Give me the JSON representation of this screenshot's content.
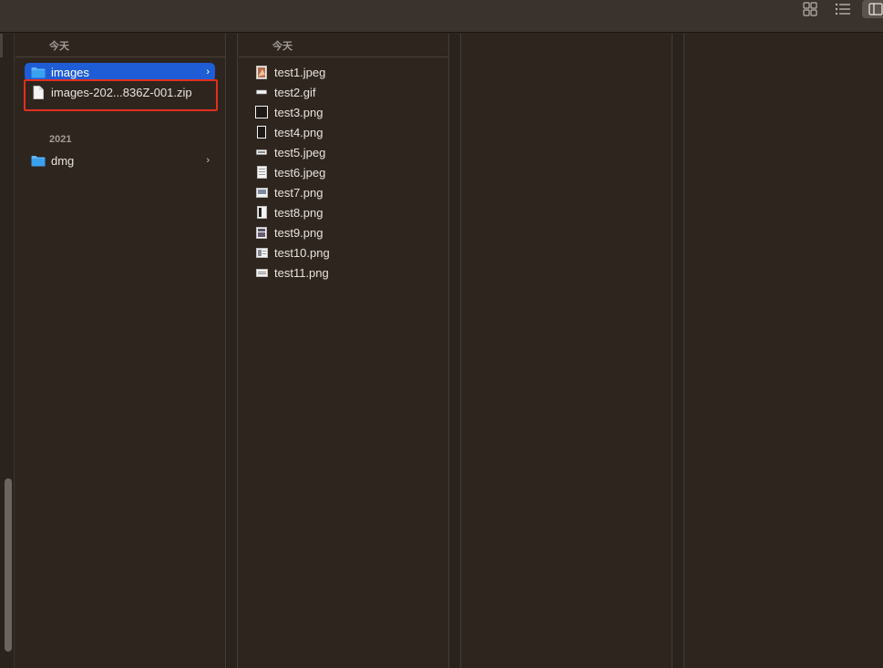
{
  "toolbar": {
    "icons": [
      "grid-view-icon",
      "list-view-icon",
      "column-view-icon"
    ]
  },
  "column1": {
    "section_today": "今天",
    "section_2021": "2021",
    "items": [
      {
        "label": "images",
        "type": "folder",
        "selected": true,
        "has_children": true
      },
      {
        "label": "images-202...836Z-001.zip",
        "type": "zip",
        "selected": false,
        "has_children": false
      },
      {
        "label": "dmg",
        "type": "folder",
        "selected": false,
        "has_children": true
      }
    ]
  },
  "column2": {
    "section_today": "今天",
    "files": [
      {
        "label": "test1.jpeg",
        "icon": "image-thumb-icon"
      },
      {
        "label": "test2.gif",
        "icon": "image-thumb-icon"
      },
      {
        "label": "test3.png",
        "icon": "image-thumb-icon"
      },
      {
        "label": "test4.png",
        "icon": "image-thumb-icon"
      },
      {
        "label": "test5.jpeg",
        "icon": "image-thumb-icon"
      },
      {
        "label": "test6.jpeg",
        "icon": "image-thumb-icon"
      },
      {
        "label": "test7.png",
        "icon": "image-thumb-icon"
      },
      {
        "label": "test8.png",
        "icon": "image-thumb-icon"
      },
      {
        "label": "test9.png",
        "icon": "image-thumb-icon"
      },
      {
        "label": "test10.png",
        "icon": "image-thumb-icon"
      },
      {
        "label": "test11.png",
        "icon": "image-thumb-icon"
      }
    ]
  },
  "chevron_glyph": "›",
  "colors": {
    "background": "#2e251f",
    "selection": "#1f5dd6",
    "folder_blue": "#3aa0f0",
    "highlight_red": "#e0301e"
  }
}
